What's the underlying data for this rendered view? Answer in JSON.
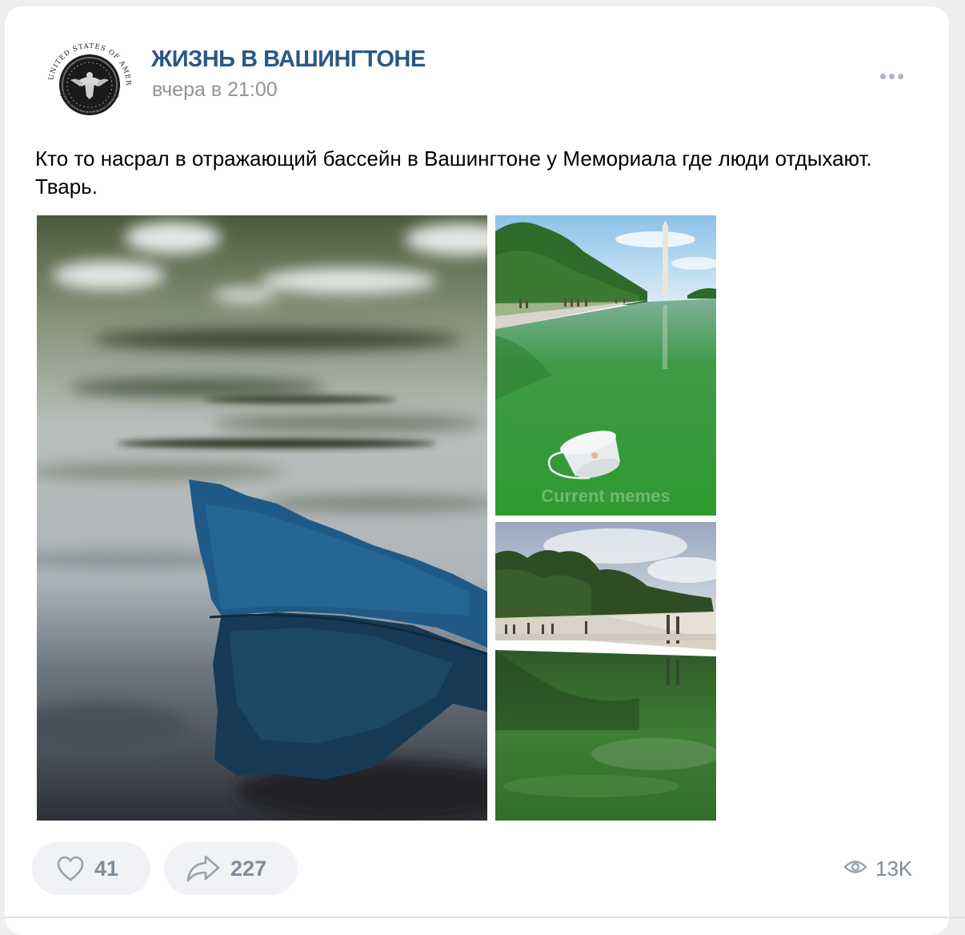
{
  "post": {
    "group_name": "ЖИЗНЬ В ВАШИНГТОНЕ",
    "time": "вчера в 21:00",
    "text": "Кто то насрал в отражающий бассейн в Вашингтоне у Мемориала где люди отдыхают. Тварь.",
    "avatar": {
      "icon": "seal-logo",
      "seal_text_top": "THE UNITED STATES OF AMERICA",
      "seal_text_bottom": "WASHINGTON DC"
    }
  },
  "photos": [
    {
      "name": "blue-object-in-water-photo"
    },
    {
      "name": "green-pool-with-cup-photo",
      "watermark": "Current memes"
    },
    {
      "name": "green-pool-with-people-photo"
    }
  ],
  "actions": {
    "likes": "41",
    "shares": "227",
    "views": "13K",
    "like_icon": "heart-icon",
    "share_icon": "share-arrow-icon",
    "views_icon": "eye-icon",
    "more_icon": "more-dots-icon"
  },
  "colors": {
    "group_name": "#2a5885",
    "secondary_text": "#939393",
    "action_text": "#818c99",
    "pill_bg": "#f0f2f5",
    "background": "#edeef0"
  }
}
